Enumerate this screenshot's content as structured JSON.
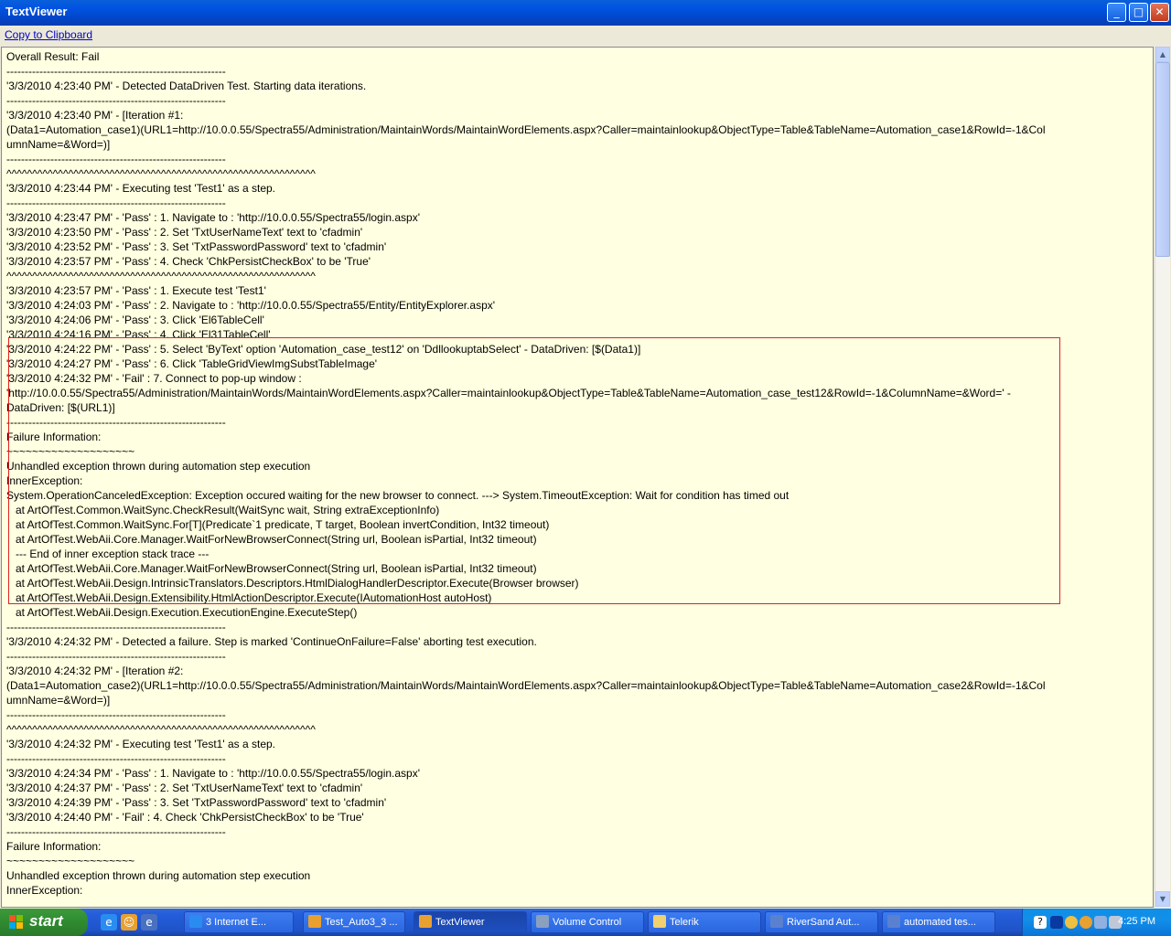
{
  "window": {
    "title": "TextViewer",
    "min": "_",
    "max": "□",
    "close": "✕"
  },
  "toolbar": {
    "copy_label": "Copy to Clipboard"
  },
  "log_lines": [
    "Overall Result: Fail",
    "------------------------------------------------------------",
    "'3/3/2010 4:23:40 PM' - Detected DataDriven Test. Starting data iterations.",
    "------------------------------------------------------------",
    "'3/3/2010 4:23:40 PM' - [Iteration #1:",
    "(Data1=Automation_case1)(URL1=http://10.0.0.55/Spectra55/Administration/MaintainWords/MaintainWordElements.aspx?Caller=maintainlookup&ObjectType=Table&TableName=Automation_case1&RowId=-1&Col",
    "umnName=&Word=)]",
    "------------------------------------------------------------",
    "^^^^^^^^^^^^^^^^^^^^^^^^^^^^^^^^^^^^^^^^^^^^^^^^^^^^^^^^^^^^",
    "'3/3/2010 4:23:44 PM' - Executing test 'Test1' as a step.",
    "------------------------------------------------------------",
    "'3/3/2010 4:23:47 PM' - 'Pass' : 1. Navigate to : 'http://10.0.0.55/Spectra55/login.aspx'",
    "'3/3/2010 4:23:50 PM' - 'Pass' : 2. Set 'TxtUserNameText' text to 'cfadmin'",
    "'3/3/2010 4:23:52 PM' - 'Pass' : 3. Set 'TxtPasswordPassword' text to 'cfadmin'",
    "'3/3/2010 4:23:57 PM' - 'Pass' : 4. Check 'ChkPersistCheckBox' to be 'True'",
    "^^^^^^^^^^^^^^^^^^^^^^^^^^^^^^^^^^^^^^^^^^^^^^^^^^^^^^^^^^^^",
    "'3/3/2010 4:23:57 PM' - 'Pass' : 1. Execute test 'Test1'",
    "'3/3/2010 4:24:03 PM' - 'Pass' : 2. Navigate to : 'http://10.0.0.55/Spectra55/Entity/EntityExplorer.aspx'",
    "'3/3/2010 4:24:06 PM' - 'Pass' : 3. Click 'El6TableCell'",
    "'3/3/2010 4:24:16 PM' - 'Pass' : 4. Click 'El31TableCell'",
    "'3/3/2010 4:24:22 PM' - 'Pass' : 5. Select 'ByText' option 'Automation_case_test12' on 'DdllookuptabSelect' - DataDriven: [$(Data1)]",
    "'3/3/2010 4:24:27 PM' - 'Pass' : 6. Click 'TableGridViewImgSubstTableImage'",
    "'3/3/2010 4:24:32 PM' - 'Fail' : 7. Connect to pop-up window :",
    "'http://10.0.0.55/Spectra55/Administration/MaintainWords/MaintainWordElements.aspx?Caller=maintainlookup&ObjectType=Table&TableName=Automation_case_test12&RowId=-1&ColumnName=&Word=' -",
    "DataDriven: [$(URL1)]",
    "------------------------------------------------------------",
    "Failure Information:",
    "~~~~~~~~~~~~~~~~~~~~",
    "Unhandled exception thrown during automation step execution",
    "InnerException:",
    "System.OperationCanceledException: Exception occured waiting for the new browser to connect. ---> System.TimeoutException: Wait for condition has timed out",
    "   at ArtOfTest.Common.WaitSync.CheckResult(WaitSync wait, String extraExceptionInfo)",
    "   at ArtOfTest.Common.WaitSync.For[T](Predicate`1 predicate, T target, Boolean invertCondition, Int32 timeout)",
    "   at ArtOfTest.WebAii.Core.Manager.WaitForNewBrowserConnect(String url, Boolean isPartial, Int32 timeout)",
    "   --- End of inner exception stack trace ---",
    "   at ArtOfTest.WebAii.Core.Manager.WaitForNewBrowserConnect(String url, Boolean isPartial, Int32 timeout)",
    "   at ArtOfTest.WebAii.Design.IntrinsicTranslators.Descriptors.HtmlDialogHandlerDescriptor.Execute(Browser browser)",
    "   at ArtOfTest.WebAii.Design.Extensibility.HtmlActionDescriptor.Execute(IAutomationHost autoHost)",
    "   at ArtOfTest.WebAii.Design.Execution.ExecutionEngine.ExecuteStep()",
    "------------------------------------------------------------",
    "'3/3/2010 4:24:32 PM' - Detected a failure. Step is marked 'ContinueOnFailure=False' aborting test execution.",
    "------------------------------------------------------------",
    "'3/3/2010 4:24:32 PM' - [Iteration #2:",
    "(Data1=Automation_case2)(URL1=http://10.0.0.55/Spectra55/Administration/MaintainWords/MaintainWordElements.aspx?Caller=maintainlookup&ObjectType=Table&TableName=Automation_case2&RowId=-1&Col",
    "umnName=&Word=)]",
    "------------------------------------------------------------",
    "^^^^^^^^^^^^^^^^^^^^^^^^^^^^^^^^^^^^^^^^^^^^^^^^^^^^^^^^^^^^",
    "'3/3/2010 4:24:32 PM' - Executing test 'Test1' as a step.",
    "------------------------------------------------------------",
    "'3/3/2010 4:24:34 PM' - 'Pass' : 1. Navigate to : 'http://10.0.0.55/Spectra55/login.aspx'",
    "'3/3/2010 4:24:37 PM' - 'Pass' : 2. Set 'TxtUserNameText' text to 'cfadmin'",
    "'3/3/2010 4:24:39 PM' - 'Pass' : 3. Set 'TxtPasswordPassword' text to 'cfadmin'",
    "'3/3/2010 4:24:40 PM' - 'Fail' : 4. Check 'ChkPersistCheckBox' to be 'True'",
    "------------------------------------------------------------",
    "Failure Information:",
    "~~~~~~~~~~~~~~~~~~~~",
    "Unhandled exception thrown during automation step execution",
    "InnerException:"
  ],
  "scrollbar": {
    "up": "▲",
    "down": "▼"
  },
  "taskbar": {
    "start_label": "start",
    "tasks": [
      {
        "label": "3 Internet E...",
        "icon": "ie-icon",
        "color": "#2a8cf0"
      },
      {
        "label": "Test_Auto3_3 ...",
        "icon": "app-icon",
        "color": "#e8a030"
      },
      {
        "label": "TextViewer",
        "icon": "app-icon",
        "color": "#e8a030"
      },
      {
        "label": "Volume Control",
        "icon": "volume-icon",
        "color": "#8aa0c0"
      },
      {
        "label": "Telerik",
        "icon": "folder-icon",
        "color": "#f0d070"
      },
      {
        "label": "RiverSand Aut...",
        "icon": "word-icon",
        "color": "#5a80d0"
      },
      {
        "label": "automated tes...",
        "icon": "word-icon",
        "color": "#5a80d0"
      }
    ],
    "clock": "4:25 PM"
  }
}
